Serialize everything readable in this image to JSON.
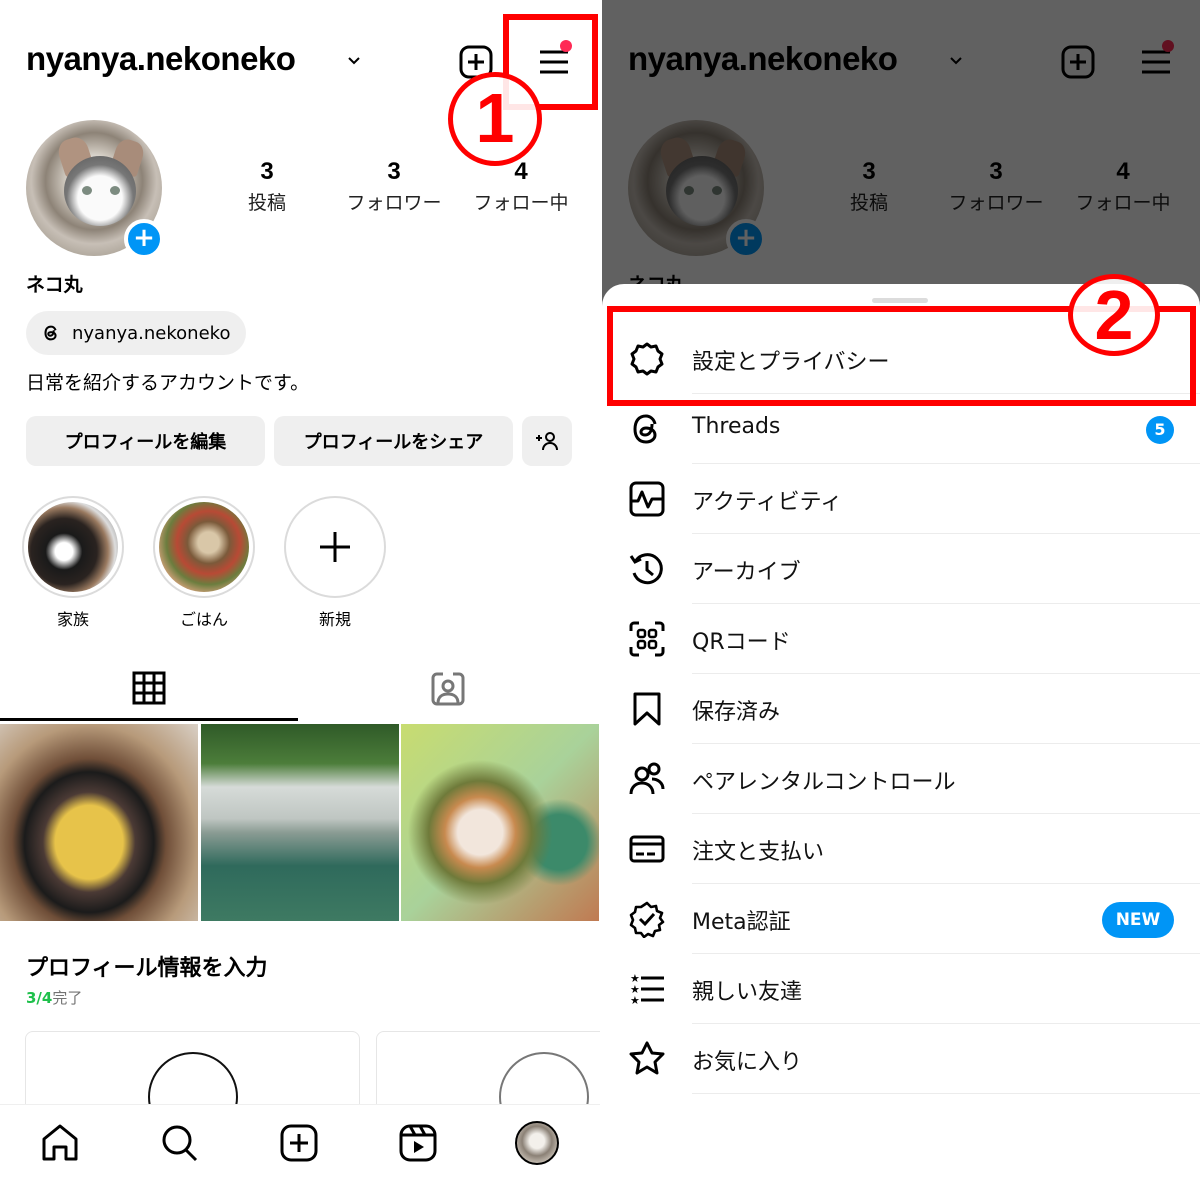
{
  "profile": {
    "username": "nyanya.nekoneko",
    "display_name": "ネコ丸",
    "threads_handle": "nyanya.nekoneko",
    "bio": "日常を紹介するアカウントです。",
    "stats": [
      {
        "value": "3",
        "label": "投稿"
      },
      {
        "value": "3",
        "label": "フォロワー"
      },
      {
        "value": "4",
        "label": "フォロー中"
      }
    ],
    "buttons": {
      "edit": "プロフィールを編集",
      "share": "プロフィールをシェア"
    },
    "highlights": [
      {
        "label": "家族"
      },
      {
        "label": "ごはん"
      },
      {
        "label": "新規"
      }
    ],
    "tabs": [
      {
        "name": "posts-grid",
        "active": true
      },
      {
        "name": "tagged",
        "active": false
      }
    ],
    "posts": [
      {
        "subject": "paella"
      },
      {
        "subject": "waterfall"
      },
      {
        "subject": "puppies"
      }
    ],
    "completion": {
      "title": "プロフィール情報を入力",
      "done": "3/4",
      "suffix": "完了"
    },
    "bottom_nav": [
      "home",
      "search",
      "create",
      "reels",
      "profile"
    ]
  },
  "menu": {
    "items": [
      {
        "label": "設定とプライバシー",
        "icon": "gear-icon"
      },
      {
        "label": "Threads",
        "icon": "threads-icon",
        "badge": "5"
      },
      {
        "label": "アクティビティ",
        "icon": "activity-icon"
      },
      {
        "label": "アーカイブ",
        "icon": "archive-icon"
      },
      {
        "label": "QRコード",
        "icon": "qr-code-icon"
      },
      {
        "label": "保存済み",
        "icon": "bookmark-icon"
      },
      {
        "label": "ペアレンタルコントロール",
        "icon": "supervision-icon"
      },
      {
        "label": "注文と支払い",
        "icon": "card-icon"
      },
      {
        "label": "Meta認証",
        "icon": "verified-icon",
        "badge": "NEW"
      },
      {
        "label": "親しい友達",
        "icon": "close-friends-icon"
      },
      {
        "label": "お気に入り",
        "icon": "star-icon"
      }
    ]
  },
  "annotations": {
    "step1": "1",
    "step2": "2"
  },
  "colors": {
    "accent_blue": "#0095f6",
    "annotation_red": "#ff0000",
    "notification_dot": "#ff2a55",
    "progress_green": "#1ec04b"
  }
}
